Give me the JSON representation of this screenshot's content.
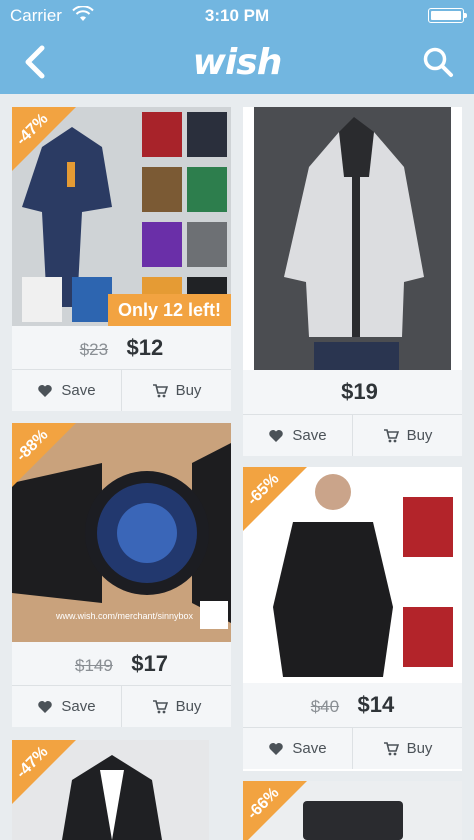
{
  "status": {
    "carrier": "Carrier",
    "time": "3:10 PM"
  },
  "nav": {
    "logo": "wish"
  },
  "products": [
    {
      "discount": "-47%",
      "banner": "Only 12 left!",
      "old_price": "$23",
      "price": "$12",
      "save_label": "Save",
      "buy_label": "Buy"
    },
    {
      "old_price": "",
      "price": "$19",
      "save_label": "Save",
      "buy_label": "Buy"
    },
    {
      "discount": "-88%",
      "watermark": "www.wish.com/merchant/sinnybox",
      "old_price": "$149",
      "price": "$17",
      "save_label": "Save",
      "buy_label": "Buy"
    },
    {
      "discount": "-65%",
      "old_price": "$40",
      "price": "$14",
      "save_label": "Save",
      "buy_label": "Buy"
    },
    {
      "discount": "-47%"
    },
    {
      "discount": "-66%"
    }
  ],
  "colors": {
    "nav": "#72b6e0",
    "ribbon": "#f2a341",
    "bg": "#e8ecef"
  }
}
